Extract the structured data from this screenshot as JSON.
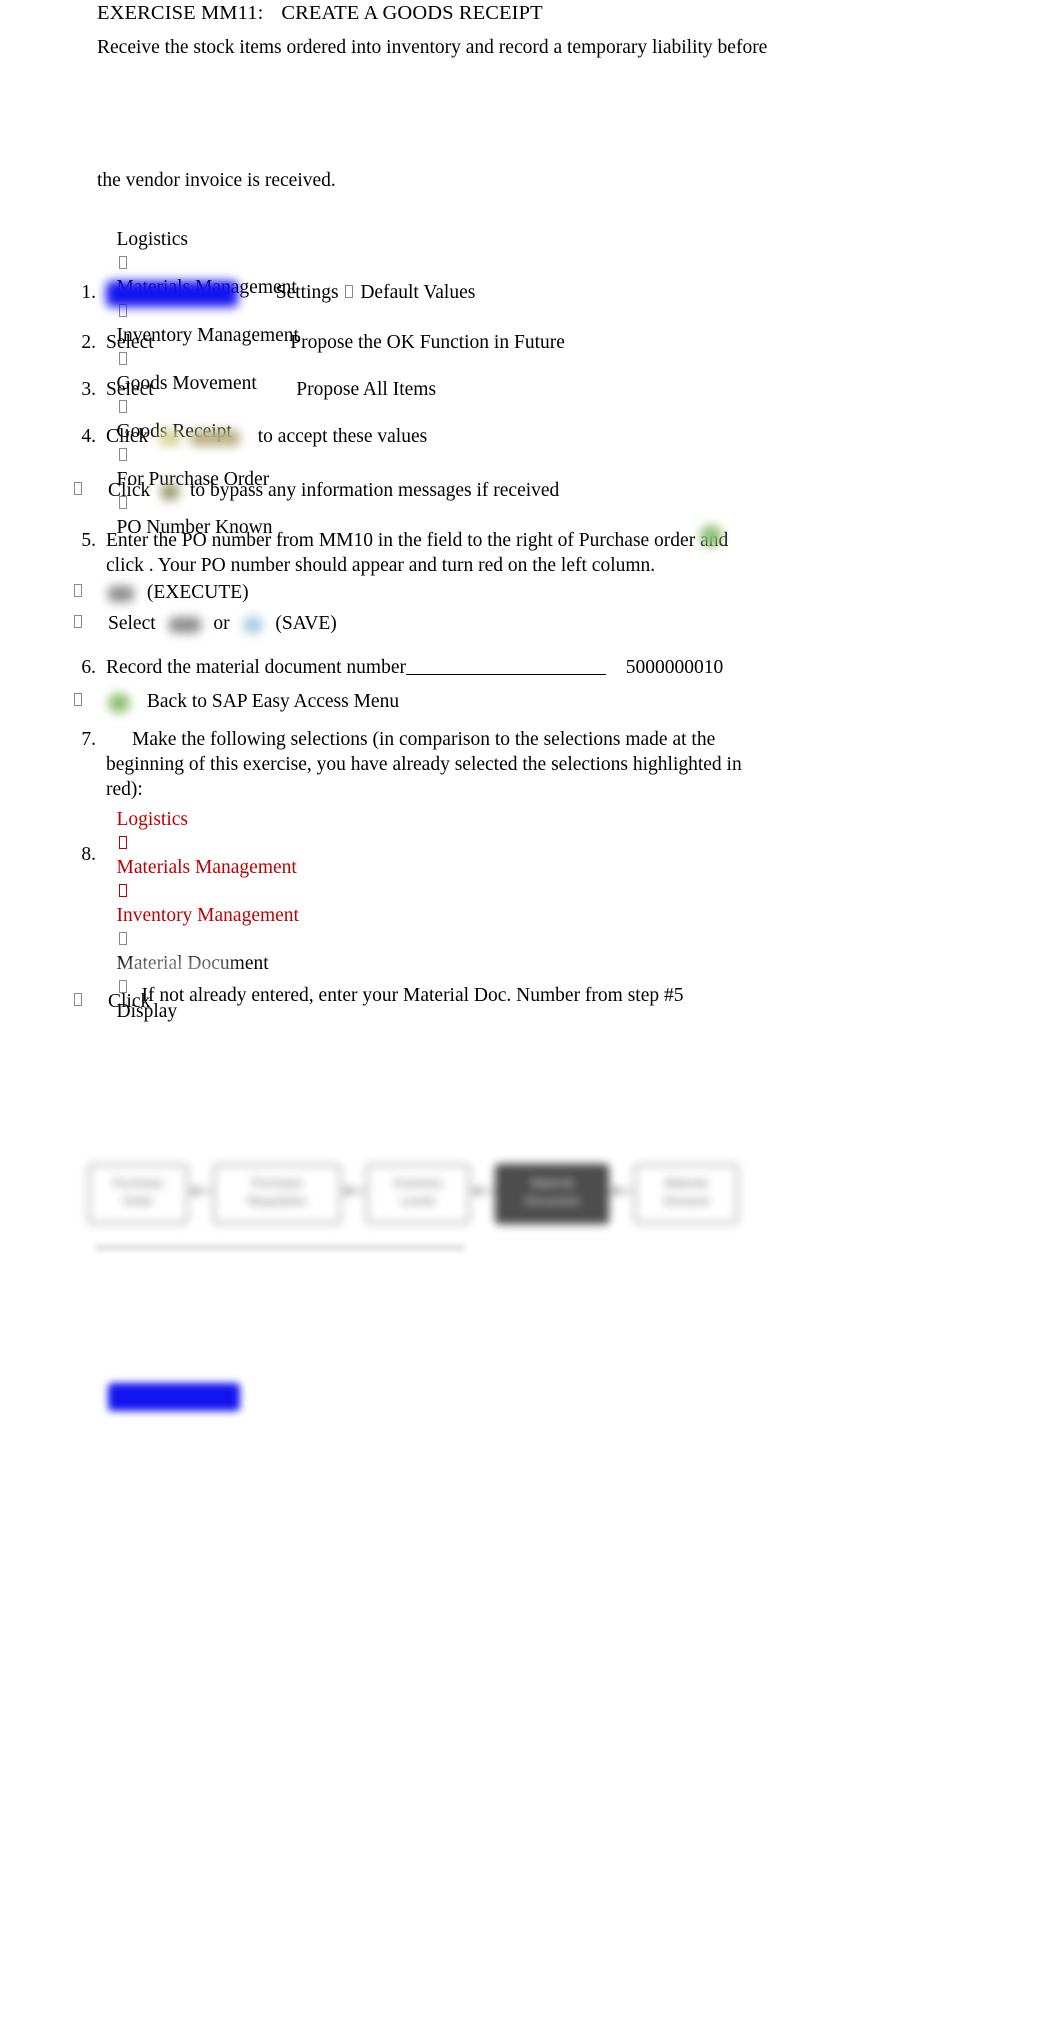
{
  "document": {
    "title_prefix": "EXERCISE MM11:",
    "title_main": "CREATE A GOODS RECEIPT",
    "intro_line_1": "Receive the stock items ordered into inventory and record a temporary liability before",
    "intro_line_2": "the vendor invoice is received."
  },
  "nav_path_top": {
    "items": [
      "Logistics",
      "Materials Management",
      "Inventory Management",
      "Goods Movement",
      "Goods Receipt",
      "For Purchase Order",
      "PO Number Known"
    ]
  },
  "steps": [
    {
      "number": "1.",
      "text_after_image": "Settings",
      "text_tail": "Default Values"
    },
    {
      "number": "2.",
      "lead": "Select",
      "tail": "Propose the OK Function in Future"
    },
    {
      "number": "3.",
      "lead": "Select",
      "tail": "Propose All Items"
    },
    {
      "number": "4.",
      "lead": "Click",
      "tail": "to accept these values"
    },
    {
      "number": "5.",
      "line_1": "Enter the PO number from MM10 in the field to the right of Purchase order and click",
      "line_2": ". Your PO number should appear and turn red on the left column."
    },
    {
      "number": "6.",
      "lead": "Record the material document number",
      "value": "5000000010"
    },
    {
      "number": "7.",
      "line_1": "Make the following selections (in comparison to the selections made at the",
      "line_2": "beginning of this exercise, you have already selected the selections highlighted in red):"
    },
    {
      "number": "8.",
      "note": "If not already entered, enter your Material Doc. Number from step #5"
    }
  ],
  "bullets": [
    {
      "lead": "Click",
      "tail": "to bypass any information messages if received"
    },
    {
      "lead": "",
      "tail": "(EXECUTE)"
    },
    {
      "lead": "Select",
      "mid": "or",
      "tail": "(SAVE)"
    },
    {
      "lead": "",
      "tail": "Back to SAP Easy Access Menu"
    },
    {
      "lead": "Click",
      "tail": ""
    }
  ],
  "nav_path_bottom": {
    "red_items": [
      "Logistics",
      "Materials Management",
      "Inventory Management"
    ],
    "black_items": [
      "Material Document",
      "Display"
    ]
  },
  "flowchart": {
    "nodes": [
      {
        "line1": "Purchase",
        "line2": "Order",
        "dark": false
      },
      {
        "line1": "Purchase",
        "line2": "Requisition",
        "dark": false
      },
      {
        "line1": "Inventory",
        "line2": "Levels",
        "dark": false
      },
      {
        "line1": "Material",
        "line2": "Document",
        "dark": true
      },
      {
        "line1": "Material",
        "line2": "Demand",
        "dark": false
      }
    ]
  },
  "colors": {
    "red_accent": "#C00000",
    "blue_redaction": "#1414F0",
    "page_background": "#FFFFFF",
    "text": "#000000"
  }
}
